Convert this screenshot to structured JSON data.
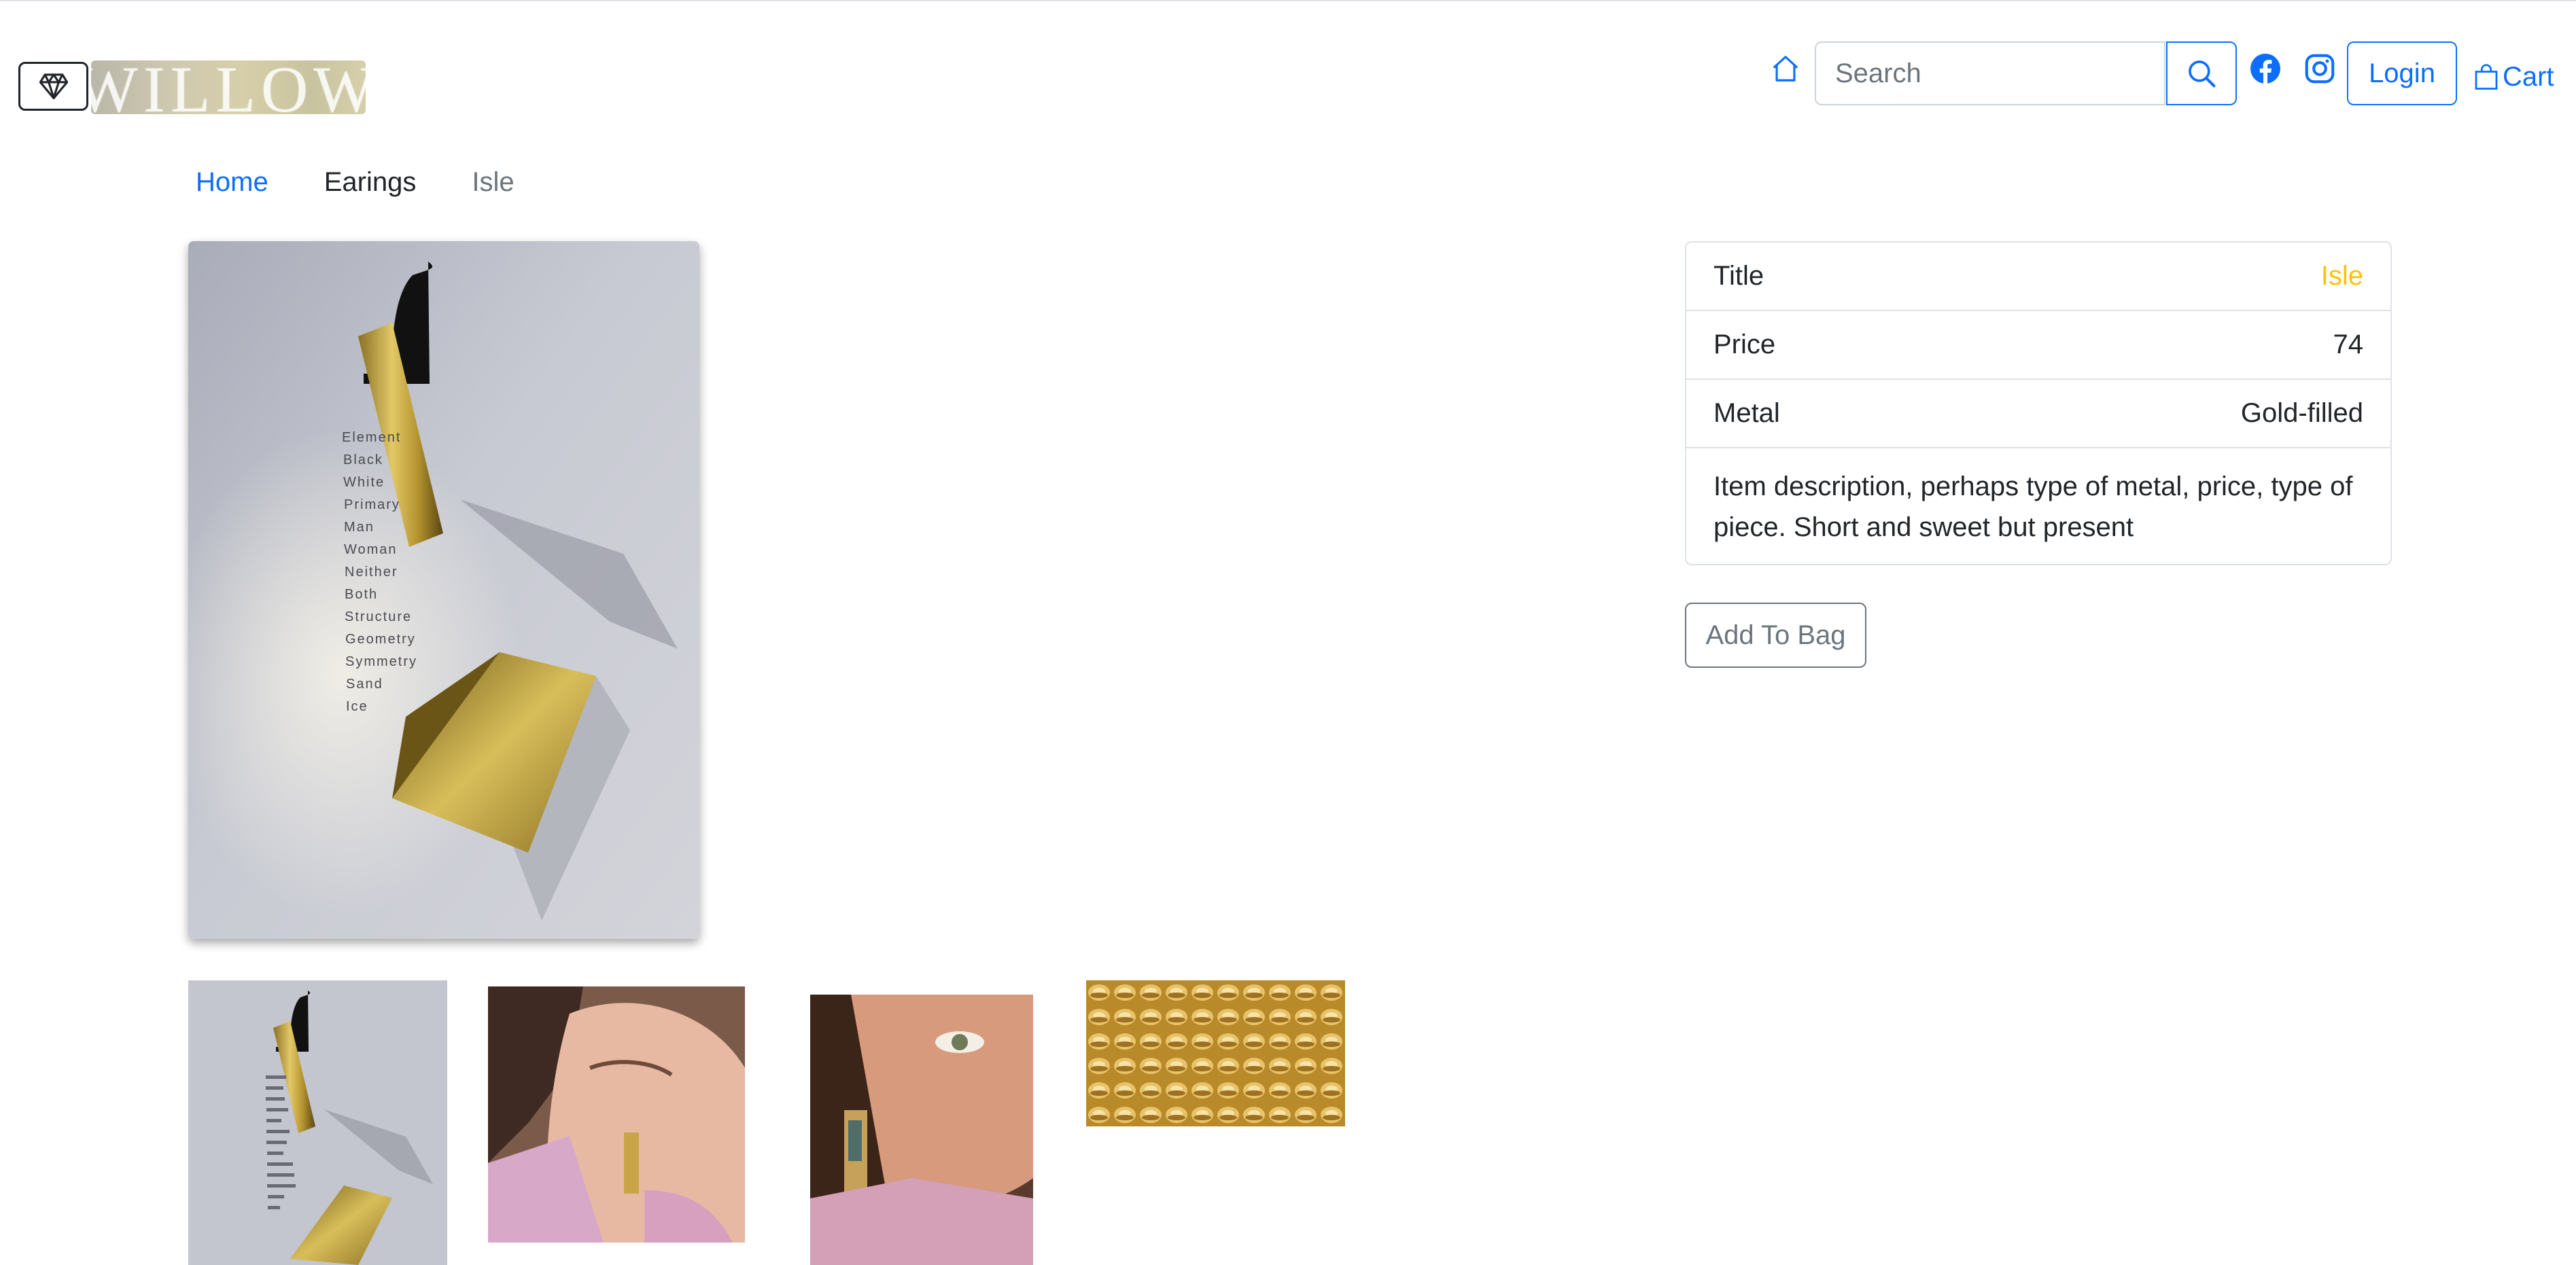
{
  "brand": {
    "logo_text": "WILLOW",
    "icon": "diamond-icon"
  },
  "header": {
    "home_icon": "house-icon",
    "search": {
      "placeholder": "Search",
      "value": "",
      "button_icon": "search-icon"
    },
    "social": [
      "facebook-icon",
      "instagram-icon"
    ],
    "login_label": "Login",
    "cart_label": "Cart",
    "cart_icon": "shopping-bag-icon"
  },
  "breadcrumb": {
    "home": "Home",
    "category": "Earings",
    "current": "Isle"
  },
  "product": {
    "rows": [
      {
        "label": "Title",
        "value": "Isle"
      },
      {
        "label": "Price",
        "value": "74"
      },
      {
        "label": "Metal",
        "value": "Gold-filled"
      }
    ],
    "description": "Item description, perhaps type of metal, price, type of piece. Short and sweet but present",
    "add_label": "Add To Bag"
  },
  "poster_words": [
    "Element",
    "Black",
    "White",
    "Primary",
    "Man",
    "Woman",
    "Neither",
    "Both",
    "Structure",
    "Geometry",
    "Symmetry",
    "Sand",
    "Ice"
  ],
  "colors": {
    "primary": "#0d6efd",
    "title_value": "#ffc107",
    "secondary": "#6c757d",
    "border": "#dee2e6"
  }
}
